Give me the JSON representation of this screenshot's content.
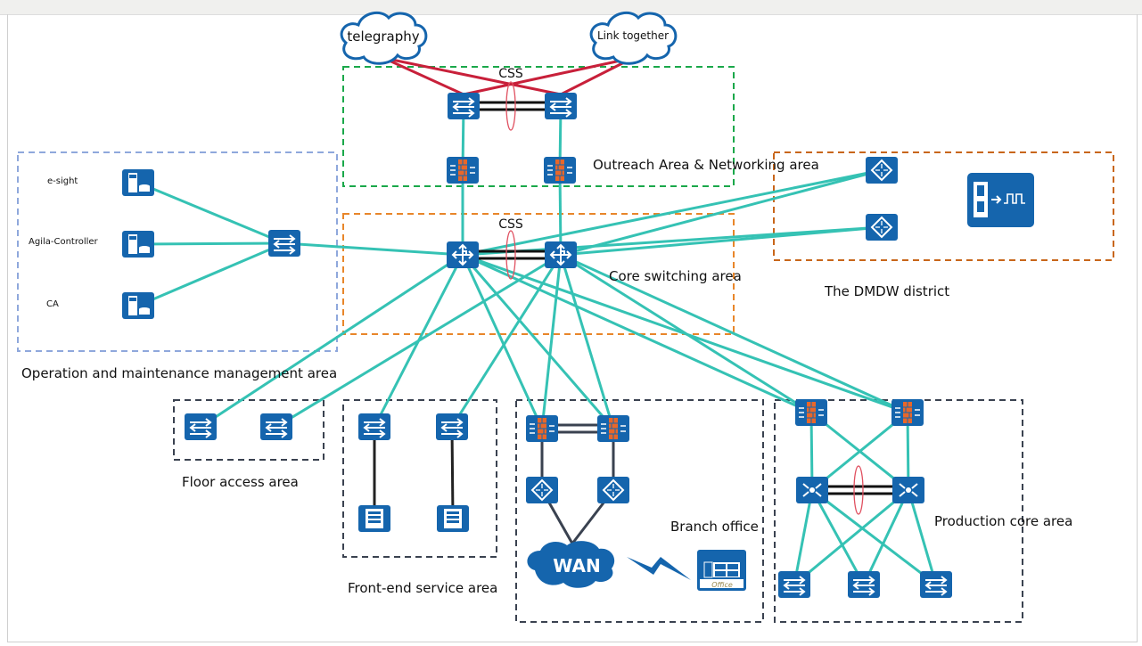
{
  "clouds": {
    "left": "telegraphy",
    "right": "Link together",
    "wan": "WAN"
  },
  "areas": {
    "outreach": {
      "label": "Outreach Area & Networking area",
      "css": "CSS"
    },
    "core": {
      "label": "Core switching area",
      "css": "CSS"
    },
    "oam": {
      "label": "Operation and maintenance management area",
      "servers": [
        "e-sight",
        "Agila-Controller",
        "CA"
      ]
    },
    "dmdw": {
      "label": "The DMDW district"
    },
    "floor": {
      "label": "Floor access area"
    },
    "frontend": {
      "label": "Front-end service area"
    },
    "branch": {
      "label": "Branch office",
      "office_icon_text": "Office"
    },
    "production": {
      "label": "Production core area"
    }
  },
  "colors": {
    "device": "#1565ad",
    "link": "#35c2b4",
    "internet_link": "#c8203a",
    "firewall": "#e8672a",
    "outreach_border": "#1aa84a",
    "core_border": "#e8862a",
    "oam_border": "#8fa8dc",
    "dmdw_border": "#c8661a",
    "area_border": "#3a4250"
  }
}
